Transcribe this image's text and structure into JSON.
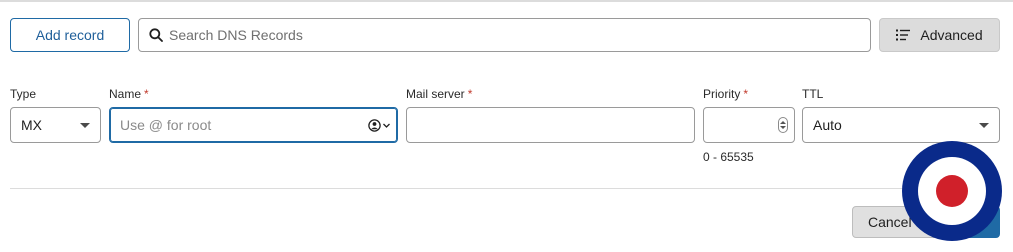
{
  "toolbar": {
    "add_record_label": "Add record",
    "search_placeholder": "Search DNS Records",
    "advanced_label": "Advanced"
  },
  "form": {
    "type": {
      "label": "Type",
      "value": "MX"
    },
    "name": {
      "label": "Name",
      "required_mark": "*",
      "placeholder": "Use @ for root"
    },
    "mail_server": {
      "label": "Mail server",
      "required_mark": "*"
    },
    "priority": {
      "label": "Priority",
      "required_mark": "*",
      "hint": "0 - 65535"
    },
    "ttl": {
      "label": "TTL",
      "value": "Auto"
    }
  },
  "footer": {
    "cancel_label": "Cancel"
  },
  "icons": {
    "search": "search-icon",
    "advanced": "filter-list-icon",
    "name_picker": "user-circle-icon",
    "overlay": "roundel-icon"
  },
  "colors": {
    "accent": "#1f6aa5",
    "required": "#c0392b",
    "roundel_outer": "#0a2a8a",
    "roundel_inner": "#d0202a"
  }
}
